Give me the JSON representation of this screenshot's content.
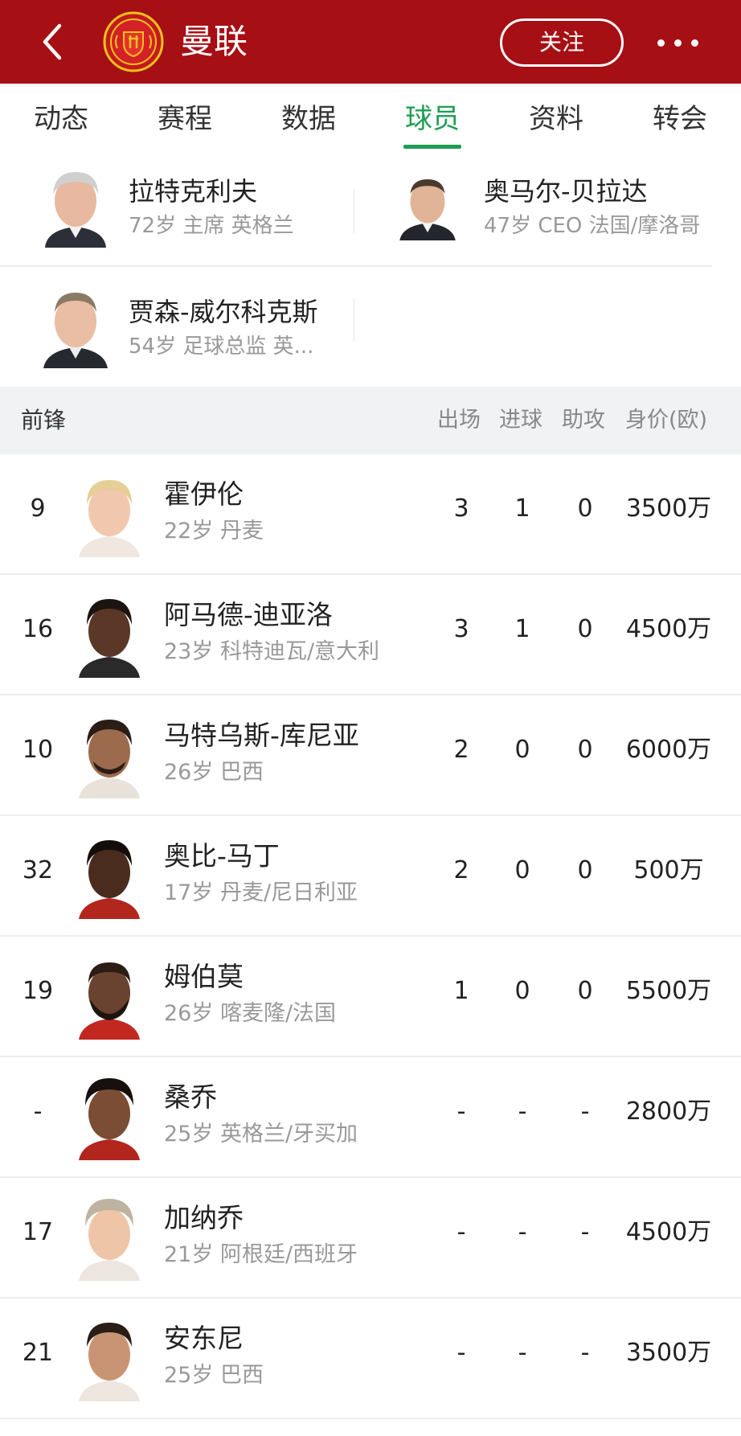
{
  "header": {
    "team_name": "曼联",
    "follow_label": "关注",
    "colors": {
      "header_bg": "#a60f14",
      "accent": "#1e9e55"
    }
  },
  "tabs": [
    {
      "label": "动态"
    },
    {
      "label": "赛程"
    },
    {
      "label": "数据"
    },
    {
      "label": "球员",
      "active": true
    },
    {
      "label": "资料"
    },
    {
      "label": "转会"
    }
  ],
  "staff": [
    {
      "name": "拉特克利夫",
      "meta": "72岁 主席 英格兰"
    },
    {
      "name": "奥马尔-贝拉达",
      "meta": "47岁 CEO 法国/摩洛哥"
    },
    {
      "name": "贾森-威尔科克斯",
      "meta": "54岁 足球总监 英..."
    }
  ],
  "section": {
    "title": "前锋",
    "columns": [
      "出场",
      "进球",
      "助攻",
      "身价(欧)"
    ]
  },
  "players": [
    {
      "number": "9",
      "name": "霍伊伦",
      "meta": "22岁 丹麦",
      "apps": "3",
      "goals": "1",
      "assists": "0",
      "value": "3500万"
    },
    {
      "number": "16",
      "name": "阿马德-迪亚洛",
      "meta": "23岁 科特迪瓦/意大利",
      "apps": "3",
      "goals": "1",
      "assists": "0",
      "value": "4500万"
    },
    {
      "number": "10",
      "name": "马特乌斯-库尼亚",
      "meta": "26岁 巴西",
      "apps": "2",
      "goals": "0",
      "assists": "0",
      "value": "6000万"
    },
    {
      "number": "32",
      "name": "奥比-马丁",
      "meta": "17岁 丹麦/尼日利亚",
      "apps": "2",
      "goals": "0",
      "assists": "0",
      "value": "500万"
    },
    {
      "number": "19",
      "name": "姆伯莫",
      "meta": "26岁 喀麦隆/法国",
      "apps": "1",
      "goals": "0",
      "assists": "0",
      "value": "5500万"
    },
    {
      "number": "-",
      "name": "桑乔",
      "meta": "25岁 英格兰/牙买加",
      "apps": "-",
      "goals": "-",
      "assists": "-",
      "value": "2800万"
    },
    {
      "number": "17",
      "name": "加纳乔",
      "meta": "21岁 阿根廷/西班牙",
      "apps": "-",
      "goals": "-",
      "assists": "-",
      "value": "4500万"
    },
    {
      "number": "21",
      "name": "安东尼",
      "meta": "25岁 巴西",
      "apps": "-",
      "goals": "-",
      "assists": "-",
      "value": "3500万"
    }
  ]
}
